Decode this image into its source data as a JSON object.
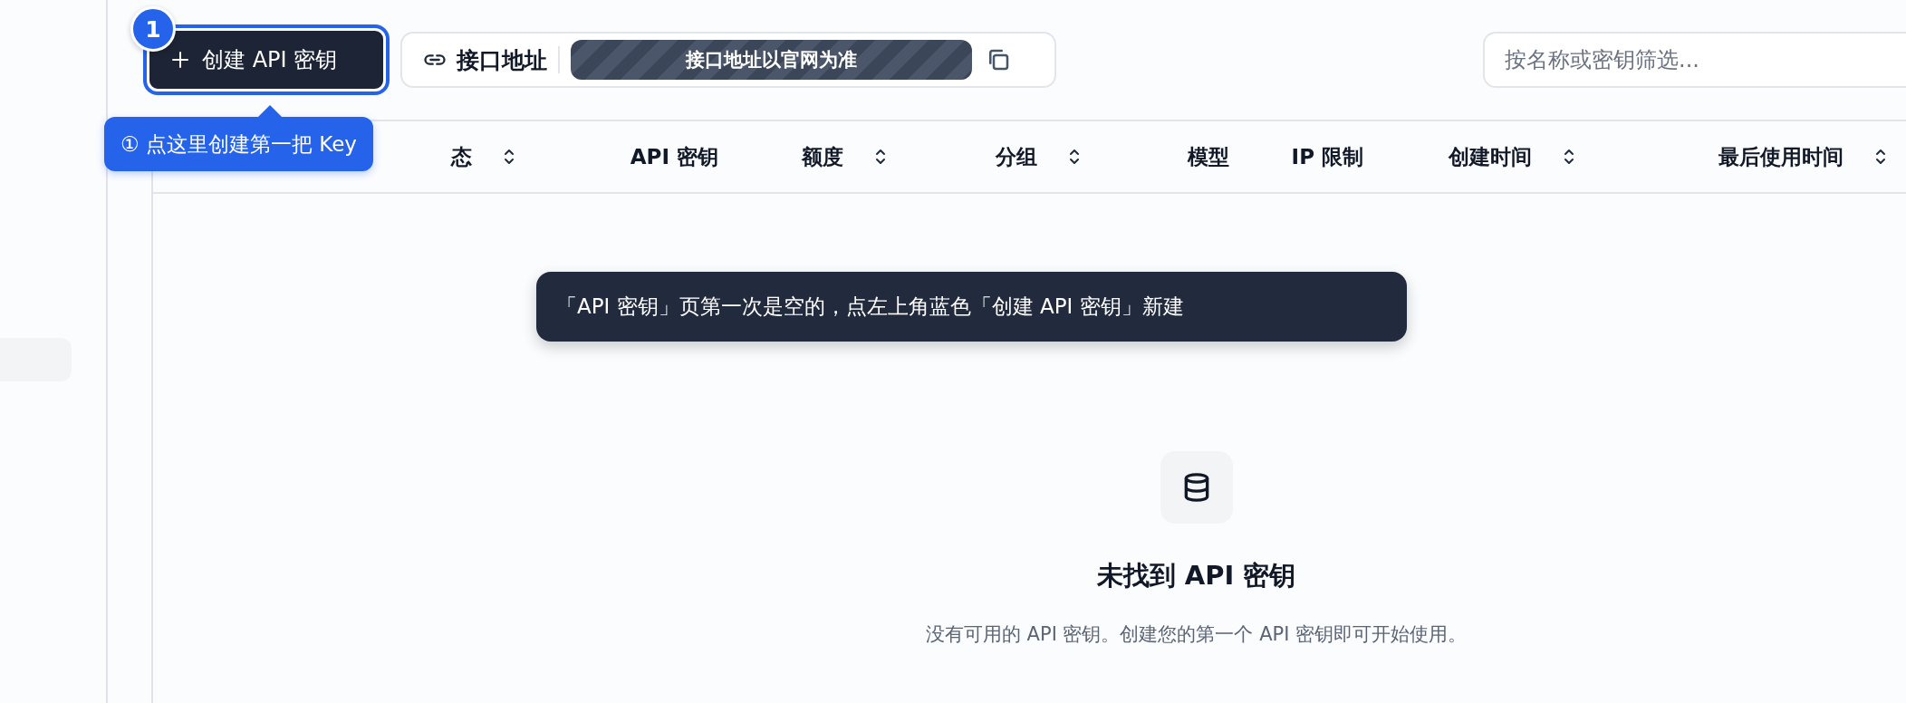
{
  "toolbar": {
    "create_button": {
      "label": "创建 API 密钥",
      "step_badge": "1"
    },
    "endpoint": {
      "label": "接口地址",
      "value": "接口地址以官网为准"
    },
    "search": {
      "placeholder": "按名称或密钥筛选..."
    }
  },
  "guide_tip": "① 点这里创建第一把 Key",
  "table": {
    "columns": [
      {
        "label": "态",
        "sortable": true
      },
      {
        "label": "API 密钥",
        "sortable": false
      },
      {
        "label": "额度",
        "sortable": true
      },
      {
        "label": "分组",
        "sortable": true
      },
      {
        "label": "模型",
        "sortable": false
      },
      {
        "label": "IP 限制",
        "sortable": false
      },
      {
        "label": "创建时间",
        "sortable": true
      },
      {
        "label": "最后使用时间",
        "sortable": true
      }
    ]
  },
  "hint_tooltip": "「API 密钥」页第一次是空的，点左上角蓝色「创建 API 密钥」新建",
  "empty_state": {
    "title": "未找到 API 密钥",
    "message": "没有可用的 API 密钥。创建您的第一个 API 密钥即可开始使用。"
  }
}
